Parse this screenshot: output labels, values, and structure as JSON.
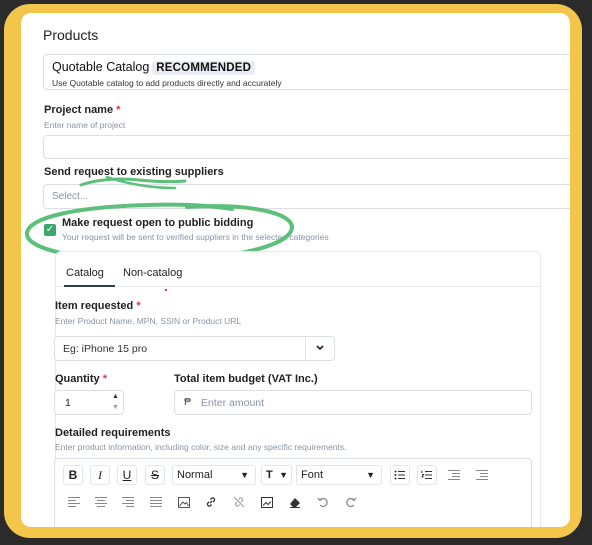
{
  "section_title": "Products",
  "catalog": {
    "title": "Quotable Catalog",
    "badge": "RECOMMENDED",
    "subtitle": "Use Quotable catalog to add products directly and accurately"
  },
  "project": {
    "label": "Project name",
    "required_mark": "*",
    "hint": "Enter name of project",
    "value": ""
  },
  "suppliers": {
    "label": "Send request to existing suppliers",
    "placeholder": "Select..."
  },
  "public_bidding": {
    "label": "Make request open to public bidding",
    "hint": "Your request will be sent to verified suppliers in the selected categories",
    "checked": true
  },
  "tabs": [
    {
      "label": "Catalog",
      "active": true
    },
    {
      "label": "Non-catalog",
      "active": false
    }
  ],
  "item": {
    "label": "Item requested",
    "required_mark": "*",
    "hint": "Enter Product Name, MPN, SSIN or Product URL",
    "placeholder": "Eg: iPhone 15 pro"
  },
  "quantity": {
    "label": "Quantity",
    "required_mark": "*",
    "value": "1"
  },
  "budget": {
    "label": "Total item budget (VAT Inc.)",
    "currency_symbol": "₱",
    "placeholder": "Enter amount"
  },
  "requirements": {
    "label": "Detailed requirements",
    "hint": "Enter product information, including color, size and any specific requirements."
  },
  "editor_toolbar": {
    "bold": "B",
    "italic": "I",
    "underline": "U",
    "strike": "S",
    "format_select": "Normal",
    "text_size_glyph": "T",
    "font_select": "Font"
  },
  "colors": {
    "frame": "#f3c54a",
    "annotation_green": "#5cc07a",
    "checkbox_green": "#3ea66b",
    "required_red": "#e0343a"
  }
}
